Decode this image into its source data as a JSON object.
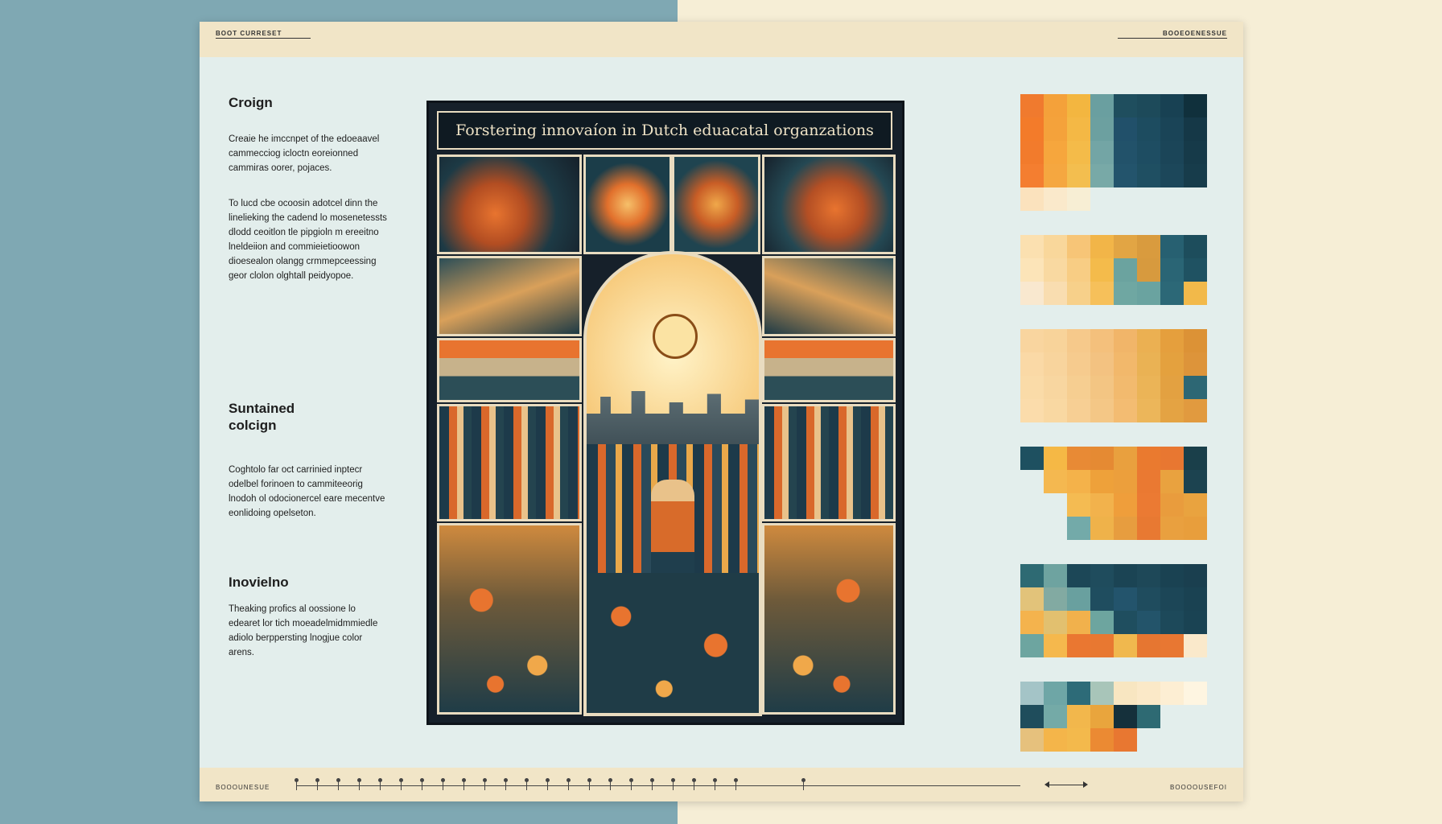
{
  "header": {
    "left_code": "BOOT CURRESET",
    "right_code": "BOOEOENESSUE"
  },
  "footer": {
    "left_code": "BOOOUNESUE",
    "right_code": "BOOOOUSEFOI"
  },
  "sections": [
    {
      "heading": "Croign",
      "paragraphs": [
        "Creaie he imccnpet of the edoeaavel cammecciog icloctn eoreionned cammiras oorer, pojaces.",
        "To lucd cbe ocoosin adotcel dinn the linelieking the cadend lo mosenetessts dlodd ceoitlon tle pipgioln m ereeitno lneldeiion and commieietioowon dioesealon olangg crmmepceessing geor clolon olghtall peidyopoe."
      ]
    },
    {
      "heading": "Suntained colcign",
      "paragraphs": [
        "Coghtolo far oct carrinied inptecr odelbel forinoen to cammiteeorig lnodoh ol odocionercel eare mecentve eonlidoing opelseton."
      ]
    },
    {
      "heading": "Inovielno",
      "paragraphs": [
        "Theaking profics al oossione lo edearet lor tich moeadelmidmmiedle adiolo berppersting lnogjue color arens."
      ]
    }
  ],
  "artwork": {
    "title": "Forstering innovaíon in Dutch eduacatal organzations",
    "colors": {
      "dark": "#16202a",
      "cream": "#e9dcc0",
      "orange": "#e8742f",
      "gold": "#e9a84a",
      "teal": "#2e6a73"
    }
  },
  "palette": {
    "rows": [
      [
        "#f07a2e",
        "#f4a13a",
        "#f3b640",
        "#6a9fa0",
        "#1f4e5e",
        "#1d4a5a",
        "#184153",
        "#10303c"
      ],
      [
        "#f37b2a",
        "#f4a23b",
        "#f4b845",
        "#6ca0a0",
        "#21506a",
        "#1d4c60",
        "#1a4457",
        "#153847"
      ],
      [
        "#f27b2c",
        "#f6a63d",
        "#f4bb49",
        "#73a5a5",
        "#22526a",
        "#1e4d62",
        "#1b4558",
        "#163a49"
      ],
      [
        "#f47e30",
        "#f5a740",
        "#f3be4f",
        "#78a9a7",
        "#23546c",
        "#1f4f62",
        "#1c475a",
        "#173c4b"
      ],
      [
        "#fbe2bd",
        "#fae9cb",
        "#f7eed4",
        "#e3eeec",
        "#e3eeec",
        "#e3eeec",
        "#e3eeec",
        "#e3eeec"
      ],
      [
        "#fbe0b0",
        "#f9d79b",
        "#f7c577",
        "#f2b548",
        "#e2a544",
        "#d99b3e",
        "#276071",
        "#1d4d5c"
      ],
      [
        "#fce4b8",
        "#f9d9a1",
        "#f8cd84",
        "#f4bb4b",
        "#6ba39f",
        "#d79a3e",
        "#2a6575",
        "#1f5262"
      ],
      [
        "#f9e8cf",
        "#f9ddb0",
        "#f7d08a",
        "#f6c05a",
        "#6fa7a2",
        "#6aa3a0",
        "#2c6877",
        "#f2b94a"
      ],
      [
        "#f9d59f",
        "#f8d39a",
        "#f6c98b",
        "#f4c07c",
        "#f1b569",
        "#ebb052",
        "#e59f3d",
        "#dc9236"
      ],
      [
        "#fad9a6",
        "#f8d49d",
        "#f6cb8e",
        "#f3c281",
        "#f2b86b",
        "#eab254",
        "#e4a13e",
        "#dd943a"
      ],
      [
        "#fadba8",
        "#f8d6a0",
        "#f6ce91",
        "#f3c583",
        "#f2ba6e",
        "#ebb457",
        "#e3a141",
        "#2d6774"
      ],
      [
        "#fbdcab",
        "#f9d8a2",
        "#f7cf94",
        "#f4c786",
        "#f3bc72",
        "#ecb65a",
        "#e4a343",
        "#e19a3f"
      ],
      [
        "#1e5060",
        "#f5b845",
        "#e88a35",
        "#e58a33",
        "#e9a03e",
        "#ea7a2f",
        "#e87731",
        "#1a3f4a"
      ],
      [
        "#e3eeec",
        "#f4b850",
        "#f4b24a",
        "#eea13a",
        "#ec9f3c",
        "#ea7932",
        "#e9a23f",
        "#1c4350"
      ],
      [
        "#e3eeec",
        "#e3eeec",
        "#f4bb52",
        "#f2b24c",
        "#ef9e3b",
        "#eb7a33",
        "#e99c3d",
        "#e9a33f"
      ],
      [
        "#e3eeec",
        "#e3eeec",
        "#73aaa9",
        "#efb24a",
        "#e79d3f",
        "#e87932",
        "#e9a03f",
        "#e89e3c"
      ],
      [
        "#2e6a73",
        "#6ea3a0",
        "#1c4757",
        "#1f4c5d",
        "#1b4454",
        "#1e4858",
        "#1a4252",
        "#1a3f4f"
      ],
      [
        "#e2c37a",
        "#82aaa2",
        "#69a09f",
        "#1f4d5f",
        "#23546c",
        "#1f4c5e",
        "#1c4657",
        "#1a4252"
      ],
      [
        "#f4b34d",
        "#e2c06f",
        "#f1b14c",
        "#6da59f",
        "#1f4e5f",
        "#23546a",
        "#1d495a",
        "#1a4353"
      ],
      [
        "#6da5a0",
        "#f5b84d",
        "#ea7731",
        "#e87831",
        "#f0b84e",
        "#e67631",
        "#e87732",
        "#fae9cb"
      ],
      [
        "#a4c4c7",
        "#6ea6a6",
        "#2d6b78",
        "#a8c5b9",
        "#f8e6c1",
        "#fbe9c8",
        "#fdeed3",
        "#fef5e1"
      ],
      [
        "#1f4d5c",
        "#74aaa7",
        "#f2b74c",
        "#e9a53d",
        "#15303b",
        "#2e6a73",
        "#e3eeec",
        "#e3eeec"
      ],
      [
        "#e6c17d",
        "#f4b54a",
        "#f3b94c",
        "#eb8a33",
        "#e87731",
        "#e3eeec",
        "#e3eeec",
        "#e3eeec"
      ],
      [
        "#f7e6c8",
        "#8fb2b3",
        "#5f9593",
        "#2c5866",
        "#1d3e4b",
        "#1a3845",
        "#dc8f3d",
        "#d5852e"
      ]
    ]
  }
}
